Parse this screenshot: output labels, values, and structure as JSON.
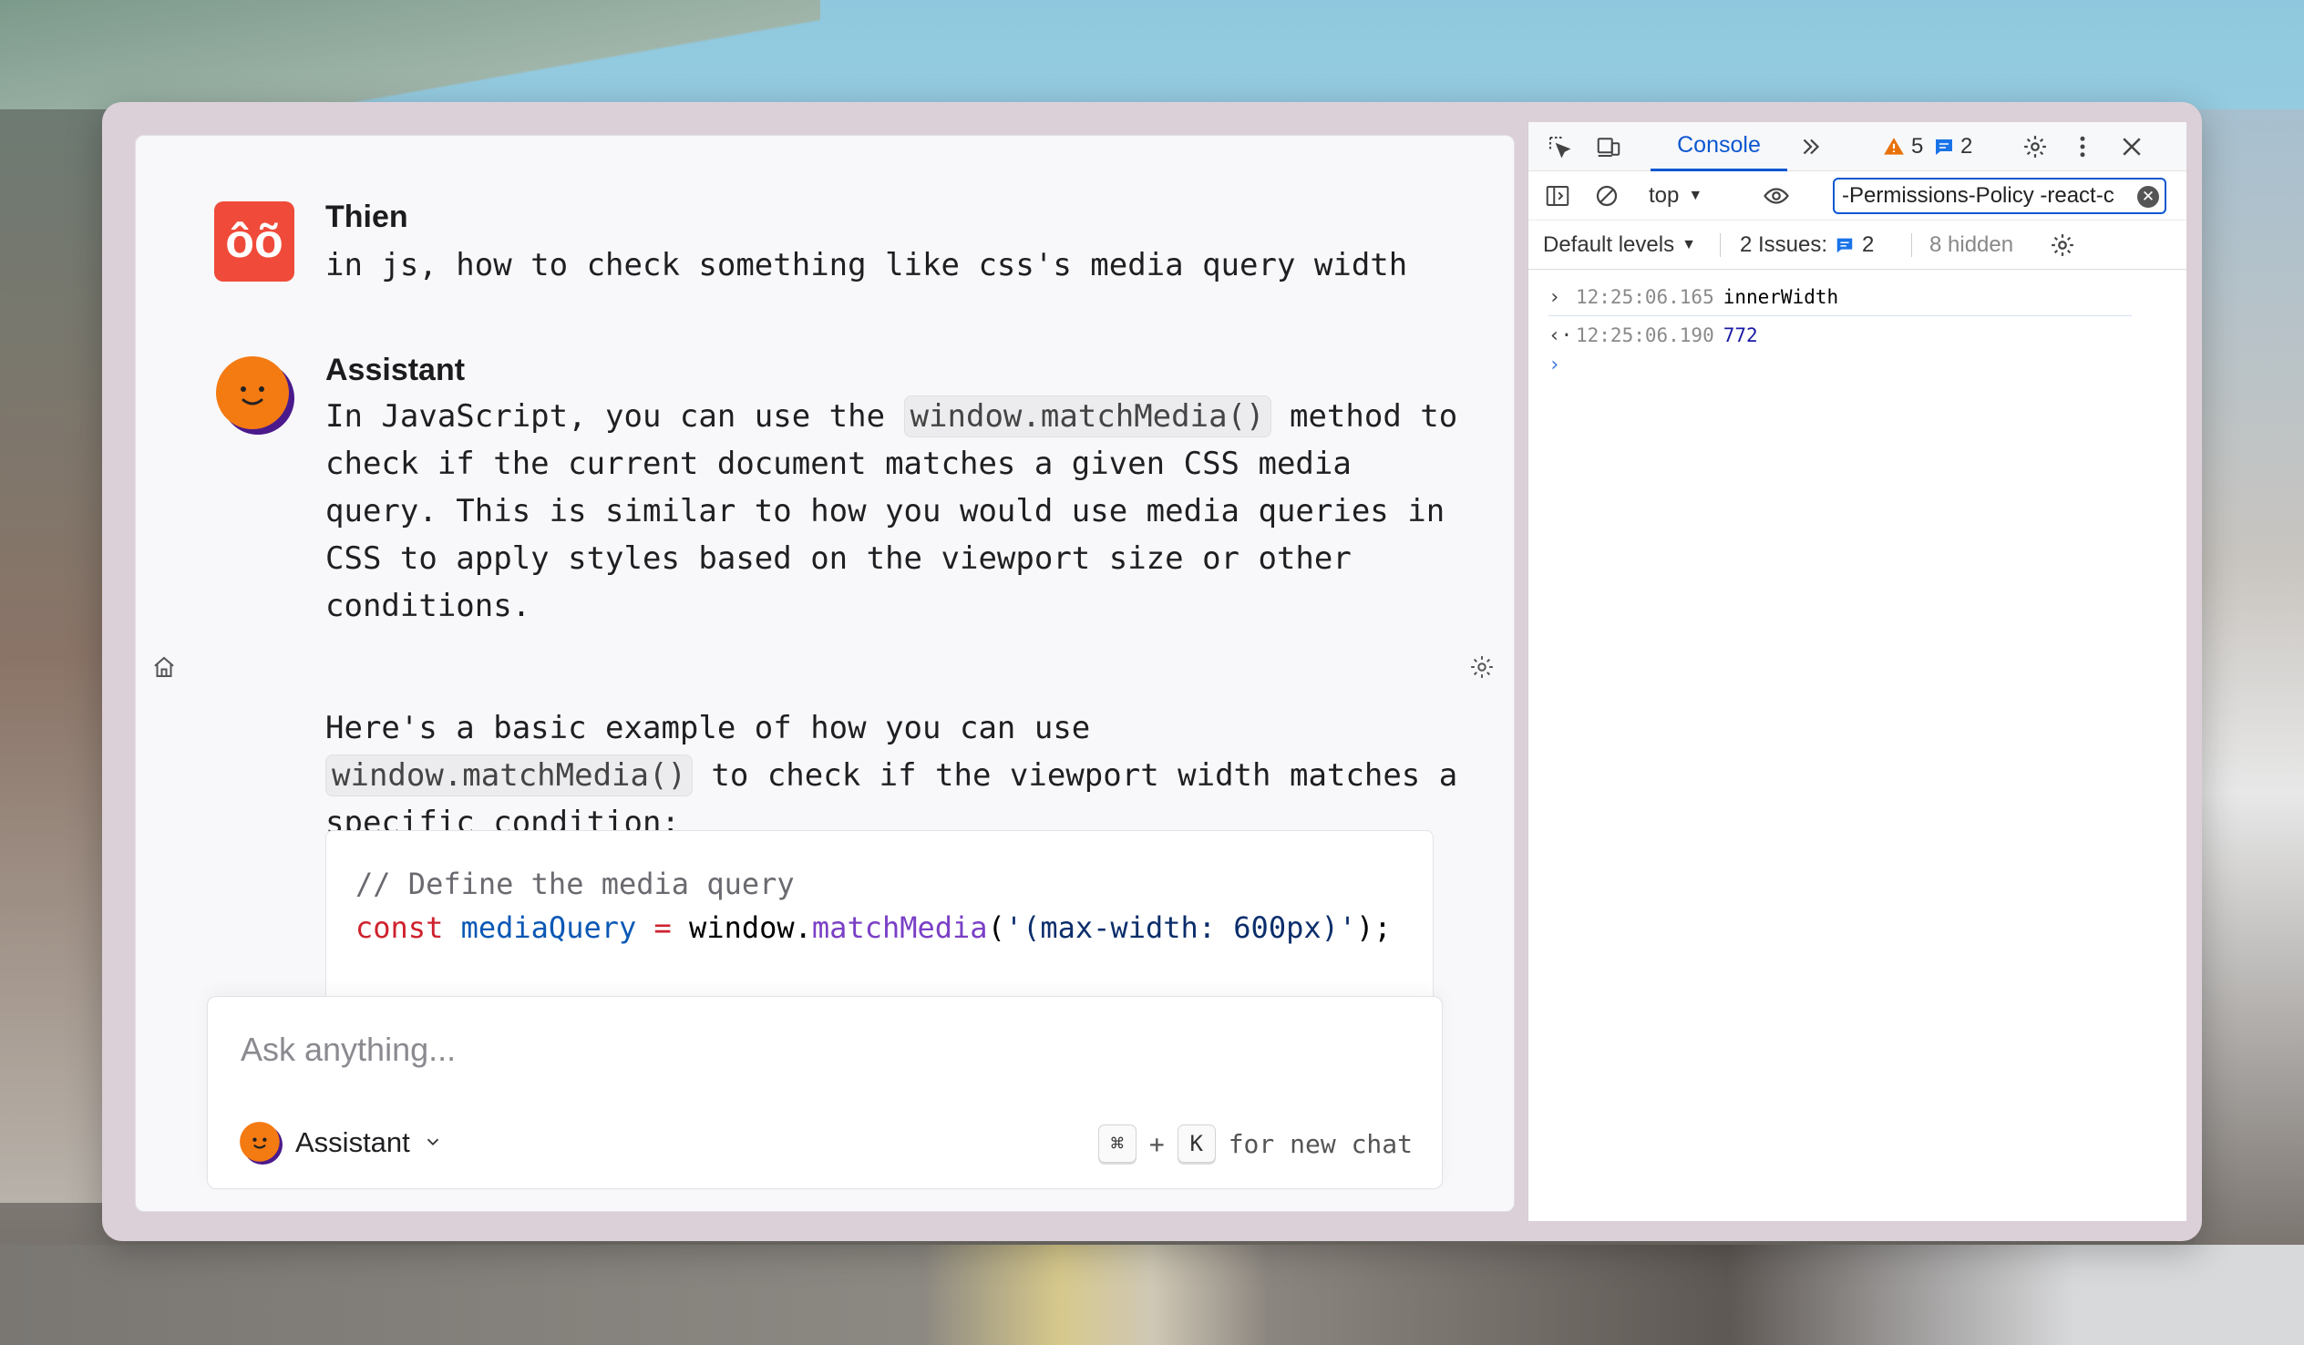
{
  "chat": {
    "user": {
      "avatar_text": "ôõ",
      "name": "Thien",
      "message": "in js, how to check something like css's media query width"
    },
    "assistant": {
      "name": "Assistant",
      "p1_before": "In JavaScript, you can use the ",
      "p1_code": "window.matchMedia()",
      "p1_after": " method to check if the current document matches a given CSS media query. This is similar to how you would use media queries in CSS to apply styles based on the viewport size or other conditions.",
      "p2_before": "Here's a basic example of how you can use ",
      "p2_code": "window.matchMedia()",
      "p2_after": " to check if the viewport width matches a specific condition:",
      "code": {
        "comment": "// Define the media query",
        "kw": "const",
        "var": "mediaQuery",
        "op": "=",
        "obj": "window.",
        "fn": "matchMedia",
        "open": "(",
        "str": "'(max-width: 600px)'",
        "close": ");"
      }
    },
    "input": {
      "placeholder": "Ask anything...",
      "value": ""
    },
    "model_label": "Assistant",
    "shortcut": {
      "key1": "⌘",
      "plus": "+",
      "key2": "K",
      "label": "for new chat"
    }
  },
  "devtools": {
    "tab_console": "Console",
    "warnings_count": "5",
    "messages_count": "2",
    "context": "top",
    "filter_value": "-Permissions-Policy -react-c",
    "levels": "Default levels",
    "issues_label": "2 Issues:",
    "issues_count": "2",
    "hidden_label": "8 hidden",
    "log_input": {
      "timestamp": "12:25:06.165",
      "text": "innerWidth"
    },
    "log_output": {
      "timestamp": "12:25:06.190",
      "value": "772"
    },
    "prompt": "›",
    "colors": {
      "accent": "#0b57d0",
      "warning": "#e8710a"
    }
  }
}
